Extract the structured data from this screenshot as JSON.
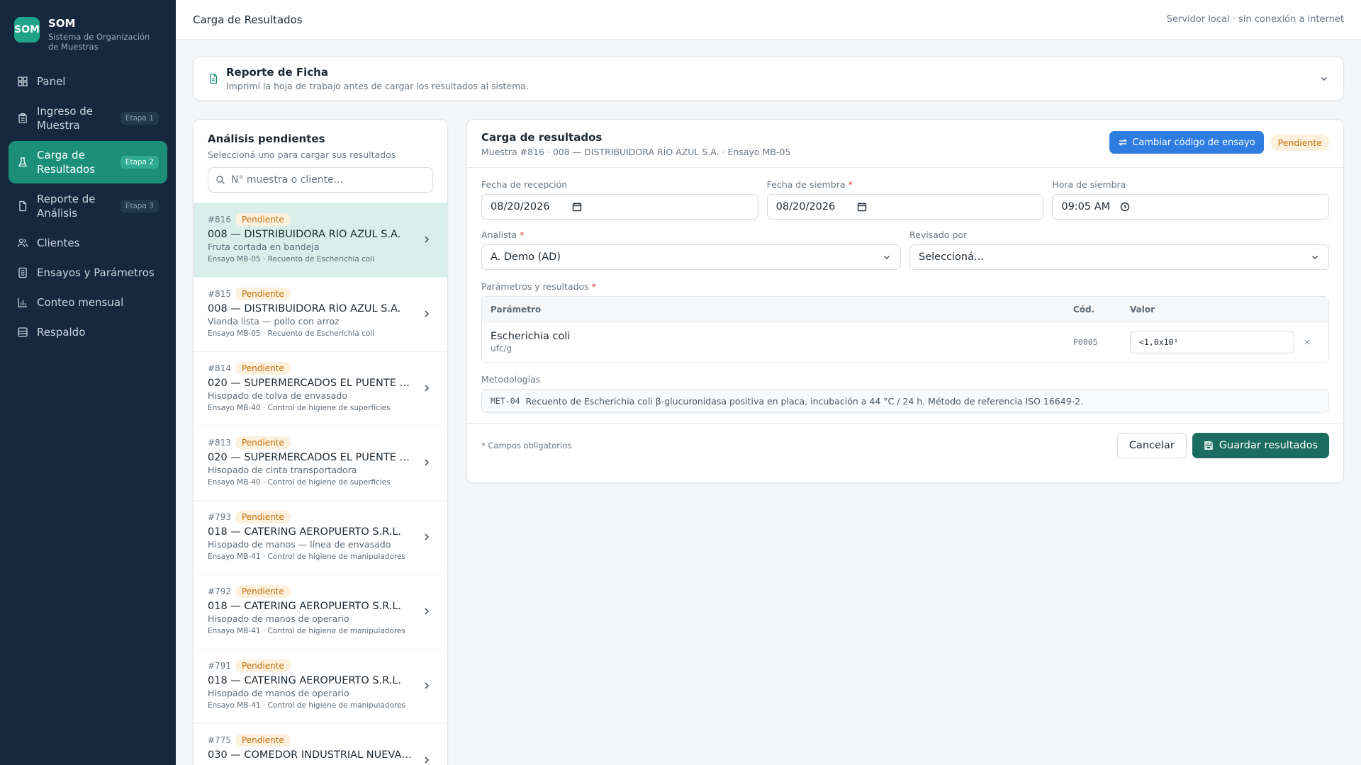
{
  "brand": {
    "logo": "SOM",
    "name": "SOM",
    "subtitle": "Sistema de Organización de Muestras"
  },
  "nav": [
    {
      "label": "Panel",
      "icon": "grid-icon",
      "stage": null
    },
    {
      "label": "Ingreso de Muestra",
      "icon": "clipboard-icon",
      "stage": "Etapa 1"
    },
    {
      "label": "Carga de Resultados",
      "icon": "flask-icon",
      "stage": "Etapa 2",
      "active": true
    },
    {
      "label": "Reporte de Análisis",
      "icon": "file-icon",
      "stage": "Etapa 3"
    },
    {
      "label": "Clientes",
      "icon": "users-icon",
      "stage": null
    },
    {
      "label": "Ensayos y Parámetros",
      "icon": "list-icon",
      "stage": null
    },
    {
      "label": "Conteo mensual",
      "icon": "bar-chart-icon",
      "stage": null
    },
    {
      "label": "Respaldo",
      "icon": "database-icon",
      "stage": null
    }
  ],
  "topbar": {
    "title": "Carga de Resultados",
    "status": "Servidor local · sin conexión a internet"
  },
  "ficha": {
    "title": "Reporte de Ficha",
    "subtitle": "Imprimí la hoja de trabajo antes de cargar los resultados al sistema."
  },
  "pending": {
    "title": "Análisis pendientes",
    "subtitle": "Seleccioná uno para cargar sus resultados",
    "search_placeholder": "N° muestra o cliente...",
    "items": [
      {
        "num": "#816",
        "status": "Pendiente",
        "client": "008 — DISTRIBUIDORA RÍO AZUL S.A.",
        "desc": "Fruta cortada en bandeja",
        "ensayo": "Ensayo MB-05 · Recuento de Escherichia coli"
      },
      {
        "num": "#815",
        "status": "Pendiente",
        "client": "008 — DISTRIBUIDORA RÍO AZUL S.A.",
        "desc": "Vianda lista — pollo con arroz",
        "ensayo": "Ensayo MB-05 · Recuento de Escherichia coli"
      },
      {
        "num": "#814",
        "status": "Pendiente",
        "client": "020 — SUPERMERCADOS EL PUENTE S.A.",
        "desc": "Hisopado de tolva de envasado",
        "ensayo": "Ensayo MB-40 · Control de higiene de superficies"
      },
      {
        "num": "#813",
        "status": "Pendiente",
        "client": "020 — SUPERMERCADOS EL PUENTE S.A.",
        "desc": "Hisopado de cinta transportadora",
        "ensayo": "Ensayo MB-40 · Control de higiene de superficies"
      },
      {
        "num": "#793",
        "status": "Pendiente",
        "client": "018 — CATERING AEROPUERTO S.R.L.",
        "desc": "Hisopado de manos — línea de envasado",
        "ensayo": "Ensayo MB-41 · Control de higiene de manipuladores"
      },
      {
        "num": "#792",
        "status": "Pendiente",
        "client": "018 — CATERING AEROPUERTO S.R.L.",
        "desc": "Hisopado de manos de operario",
        "ensayo": "Ensayo MB-41 · Control de higiene de manipuladores"
      },
      {
        "num": "#791",
        "status": "Pendiente",
        "client": "018 — CATERING AEROPUERTO S.R.L.",
        "desc": "Hisopado de manos de operario",
        "ensayo": "Ensayo MB-41 · Control de higiene de manipuladores"
      },
      {
        "num": "#775",
        "status": "Pendiente",
        "client": "030 — COMEDOR INDUSTRIAL NUEVA ...",
        "desc": "",
        "ensayo": ""
      }
    ]
  },
  "form": {
    "title": "Carga de resultados",
    "subtitle": "Muestra #816 · 008 — DISTRIBUIDORA RÍO AZUL S.A. · Ensayo MB-05",
    "change_button": "Cambiar código de ensayo",
    "status": "Pendiente",
    "fecha_recepcion": {
      "label": "Fecha de recepción",
      "value": "08/20/2026"
    },
    "fecha_siembra": {
      "label": "Fecha de siembra",
      "value": "08/20/2026",
      "required": "*"
    },
    "hora_siembra": {
      "label": "Hora de siembra",
      "value": "09:05 AM"
    },
    "analista": {
      "label": "Analista",
      "value": "A. Demo (AD)",
      "required": "*"
    },
    "revisado": {
      "label": "Revisado por",
      "value": "Seleccioná..."
    },
    "parametros": {
      "label": "Parámetros y resultados",
      "required": "*",
      "headers": [
        "Parámetro",
        "Cód.",
        "Valor"
      ],
      "rows": [
        {
          "name": "Escherichia coli",
          "unit": "ufc/g",
          "code": "P0005",
          "value": "<1,0x10¹"
        }
      ]
    },
    "metodologias": {
      "label": "Metodologías",
      "code": "MET-04",
      "text": "Recuento de Escherichia coli β-glucuronidasa positiva en placa, incubación a 44 °C / 24 h. Método de referencia ISO 16649-2."
    },
    "footnote": "* Campos obligatorios",
    "cancel": "Cancelar",
    "save": "Guardar resultados"
  },
  "colors": {
    "sidebar": "#15283d",
    "accent": "#1b8f78",
    "save": "#1b6e5f",
    "blue": "#2f7de1",
    "pending_bg": "#fdf0dd",
    "pending_text": "#c2720f"
  }
}
